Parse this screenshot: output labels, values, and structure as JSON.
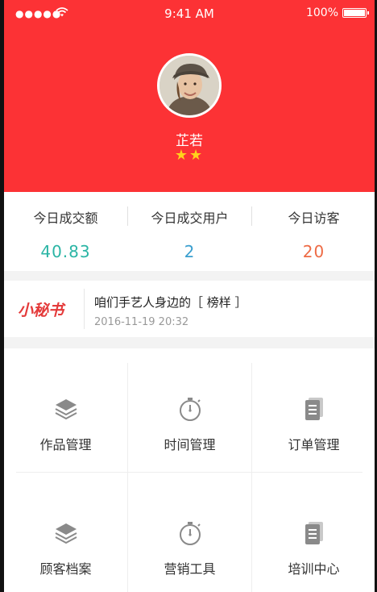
{
  "status_bar": {
    "signal": "●●●●●",
    "time": "9:41 AM",
    "battery": "100%"
  },
  "profile": {
    "name": "芷若",
    "stars": "★★",
    "star_count": 2
  },
  "stats": [
    {
      "label": "今日成交额",
      "value": "40.83",
      "color": "#2bb5a5"
    },
    {
      "label": "今日成交用户",
      "value": "2",
      "color": "#3a9fcf"
    },
    {
      "label": "今日访客",
      "value": "20",
      "color": "#ee6b45"
    }
  ],
  "notice": {
    "tag": "小秘书",
    "title": "咱们手艺人身边的［ 榜样 ］",
    "date": "2016-11-19 20:32"
  },
  "menu": [
    {
      "label": "作品管理",
      "icon": "layers-icon"
    },
    {
      "label": "时间管理",
      "icon": "stopwatch-icon"
    },
    {
      "label": "订单管理",
      "icon": "document-icon"
    },
    {
      "label": "顾客档案",
      "icon": "layers-icon"
    },
    {
      "label": "营销工具",
      "icon": "stopwatch-icon"
    },
    {
      "label": "培训中心",
      "icon": "document-icon"
    }
  ],
  "colors": {
    "brand_red": "#fc3235",
    "star": "#ffd21c",
    "icon_gray": "#8a8a8a"
  }
}
